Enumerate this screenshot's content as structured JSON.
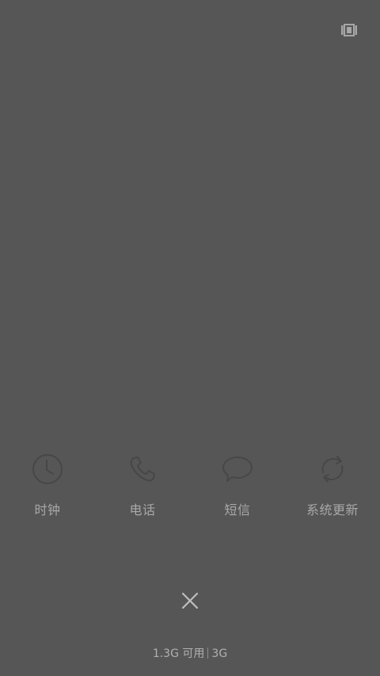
{
  "icons": {
    "top_right": "multi-window-icon",
    "close": "close-icon"
  },
  "apps": [
    {
      "label": "时钟",
      "icon": "clock-icon"
    },
    {
      "label": "电话",
      "icon": "phone-icon"
    },
    {
      "label": "短信",
      "icon": "message-icon"
    },
    {
      "label": "系统更新",
      "icon": "update-icon"
    }
  ],
  "memory": {
    "available": "1.3G 可用",
    "total": "3G"
  },
  "colors": {
    "background": "#565656",
    "foreground": "#a6a6a6"
  }
}
